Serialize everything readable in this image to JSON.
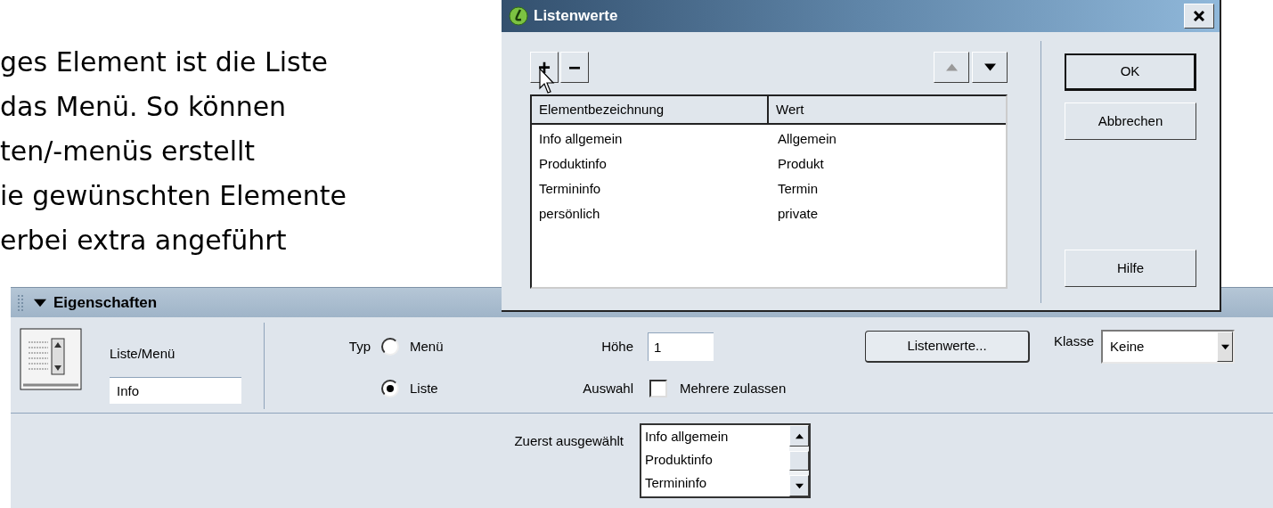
{
  "slide_text": {
    "lines": [
      "ges Element ist die Liste",
      "das Menü. So können",
      "ten/-menüs erstellt",
      "ie gewünschten Elemente",
      "erbei extra angeführt"
    ]
  },
  "dialog": {
    "title": "Listenwerte",
    "add_button": "+",
    "remove_button": "−",
    "columns": [
      "Elementbezeichnung",
      "Wert"
    ],
    "rows": [
      {
        "label": "Info allgemein",
        "value": "Allgemein"
      },
      {
        "label": "Produktinfo",
        "value": "Produkt"
      },
      {
        "label": "Termininfo",
        "value": "Termin"
      },
      {
        "label": "persönlich",
        "value": "private"
      }
    ],
    "buttons": [
      {
        "label": "OK",
        "kind": "default"
      },
      {
        "label": "Abbrechen",
        "kind": "normal"
      },
      {
        "label": "Hilfe",
        "kind": "bottom"
      }
    ]
  },
  "properties_panel": {
    "title": "Eigenschaften",
    "expanded": true,
    "element_label": "Liste/Menü",
    "name_field": {
      "value": "Info"
    },
    "type": {
      "label": "Typ",
      "options": [
        {
          "label": "Menü",
          "selected": false
        },
        {
          "label": "Liste",
          "selected": true
        }
      ]
    },
    "height": {
      "label": "Höhe",
      "value": "1"
    },
    "selection": {
      "label": "Auswahl",
      "checkbox": {
        "label": "Mehrere zulassen",
        "checked": false
      }
    },
    "list_values_button": "Listenwerte...",
    "class": {
      "label": "Klasse",
      "value": "Keine"
    },
    "initially_selected": {
      "label": "Zuerst ausgewählt",
      "items": [
        "Info allgemein",
        "Produktinfo",
        "Termininfo"
      ]
    }
  }
}
